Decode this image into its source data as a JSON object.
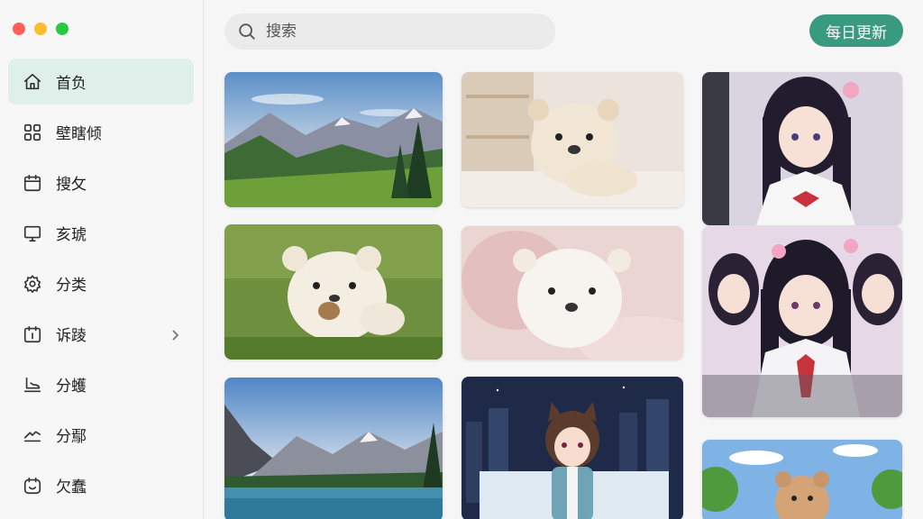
{
  "sidebar": {
    "items": [
      {
        "label": "首负",
        "icon": "home-icon",
        "active": true
      },
      {
        "label": "壁瞎倾",
        "icon": "grid-icon"
      },
      {
        "label": "搜攵",
        "icon": "calendar-icon"
      },
      {
        "label": "亥琥",
        "icon": "monitor-icon"
      },
      {
        "label": "分类",
        "icon": "gear-icon"
      },
      {
        "label": "诉踜",
        "icon": "calendar-check-icon",
        "has_chevron": true
      },
      {
        "label": "分蠖",
        "icon": "shoe-icon"
      },
      {
        "label": "分鄢",
        "icon": "sneaker-icon"
      },
      {
        "label": "欠蠢",
        "icon": "smile-icon"
      }
    ]
  },
  "search": {
    "placeholder": "搜索"
  },
  "header": {
    "daily_button": "每日更新"
  },
  "colors": {
    "accent": "#3a9a80",
    "active_bg": "#dff0ea"
  },
  "gallery": [
    {
      "subject": "mountain-landscape"
    },
    {
      "subject": "puppy-on-rug"
    },
    {
      "subject": "anime-girl"
    },
    {
      "subject": "puppy-in-grass"
    },
    {
      "subject": "puppy-on-blanket"
    },
    {
      "subject": "anime-girls-group"
    },
    {
      "subject": "mountain-lake"
    },
    {
      "subject": "anime-cat-girl-city"
    },
    {
      "subject": "cartoon-bear"
    }
  ]
}
